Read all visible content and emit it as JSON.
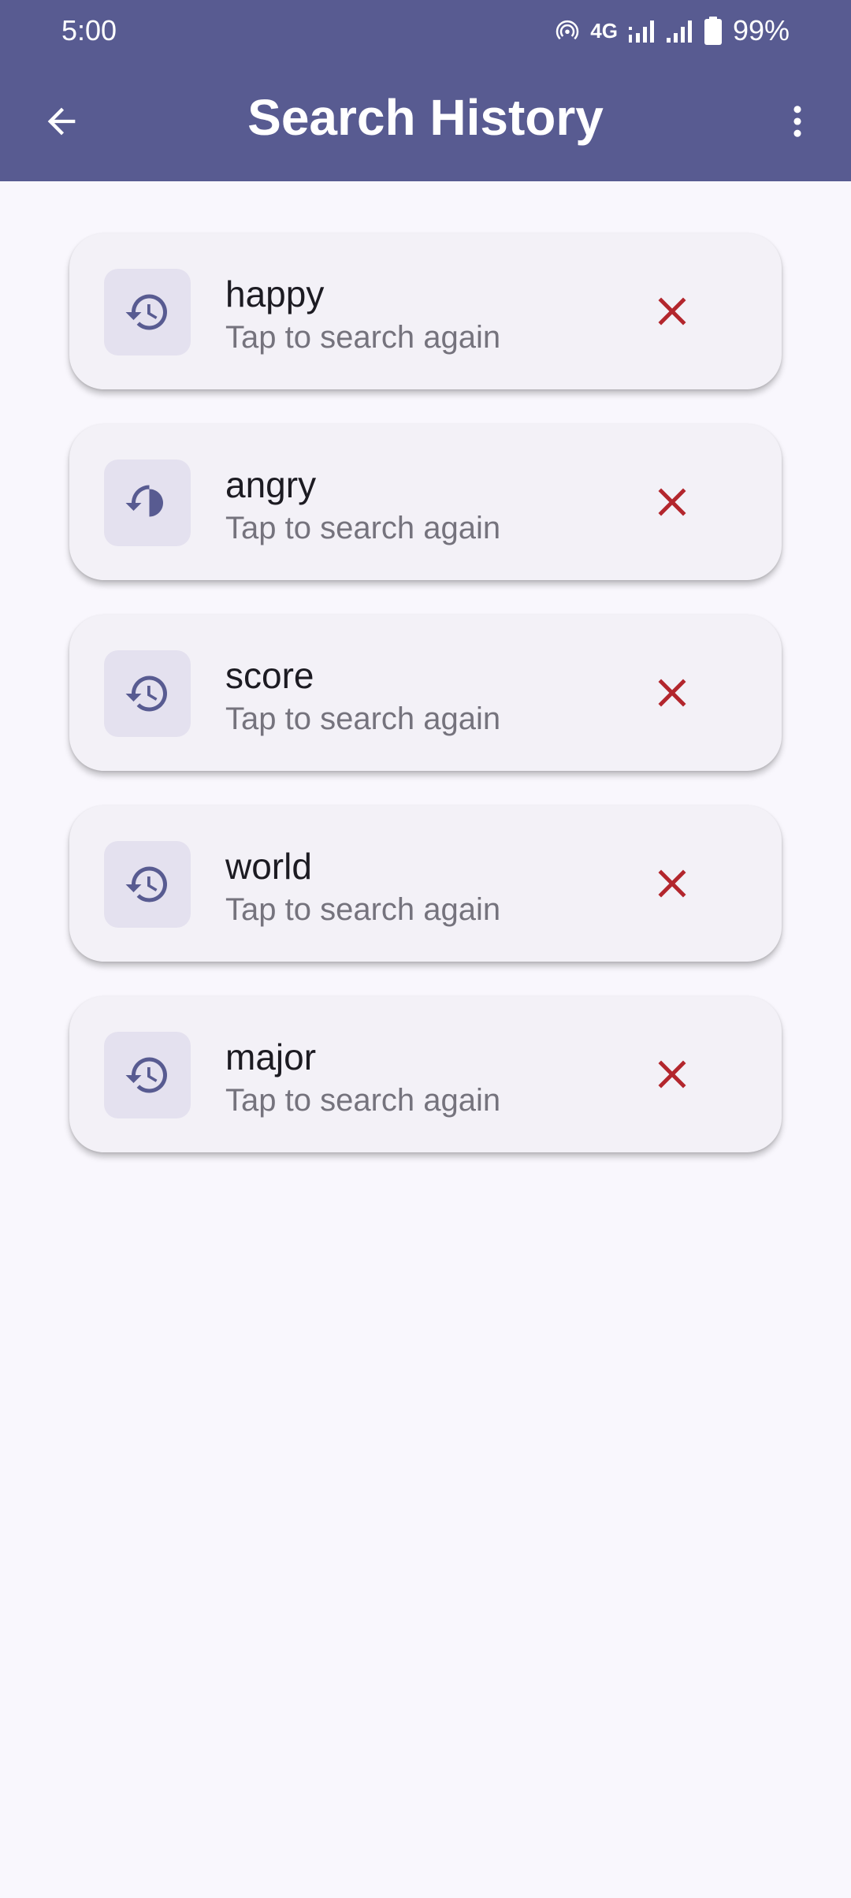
{
  "status_bar": {
    "time": "5:00",
    "network": "4G",
    "battery": "99%"
  },
  "app_bar": {
    "title": "Search History",
    "back_icon": "arrow-back-icon",
    "menu_icon": "more-vert-icon"
  },
  "history": [
    {
      "term": "happy",
      "subtitle": "Tap to search again"
    },
    {
      "term": "angry",
      "subtitle": "Tap to search again"
    },
    {
      "term": "score",
      "subtitle": "Tap to search again"
    },
    {
      "term": "world",
      "subtitle": "Tap to search again"
    },
    {
      "term": "major",
      "subtitle": "Tap to search again"
    }
  ],
  "colors": {
    "app_bar": "#585b91",
    "background": "#f9f7fd",
    "card": "#f3f1f7",
    "icon_box": "#e4e1ef",
    "history_icon": "#585b91",
    "delete_icon": "#b3262d"
  }
}
